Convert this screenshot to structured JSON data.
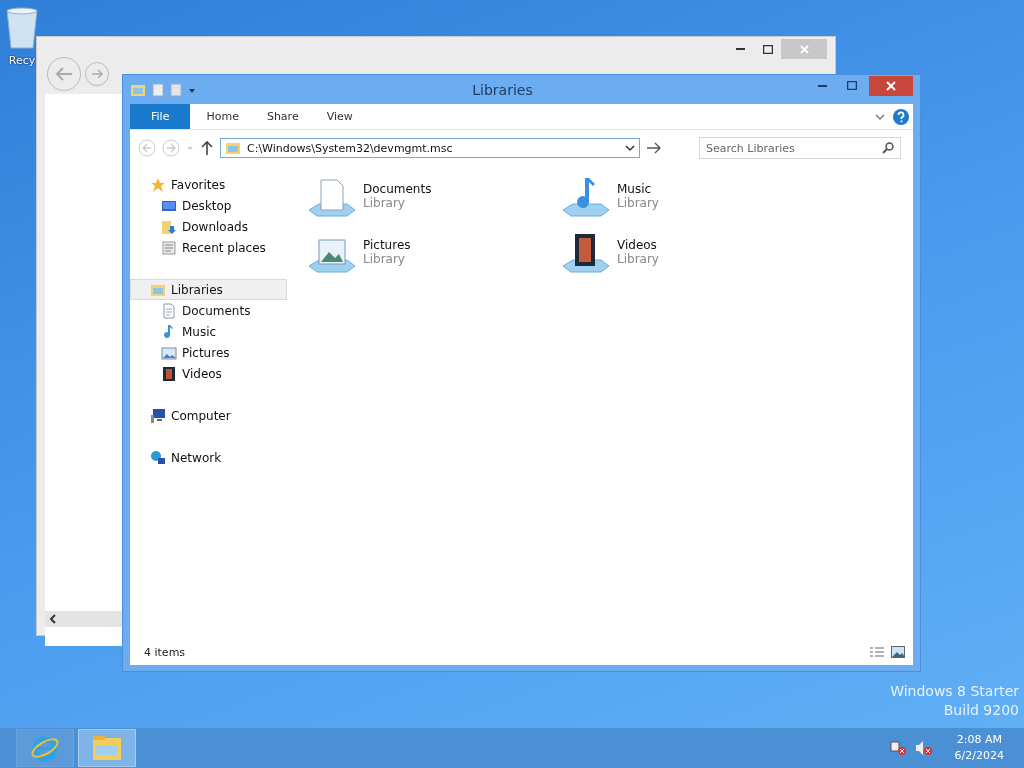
{
  "desktop_icons": [
    {
      "label": "Recy"
    }
  ],
  "browser": {
    "kind": "window"
  },
  "explorer": {
    "title": "Libraries",
    "ribbon_tabs": [
      {
        "label": "File",
        "kind": "menu"
      },
      {
        "label": "Home",
        "kind": "tab"
      },
      {
        "label": "Share",
        "kind": "tab"
      },
      {
        "label": "View",
        "kind": "tab"
      }
    ],
    "address": {
      "value": "C:\\Windows\\System32\\devmgmt.msc"
    },
    "search": {
      "placeholder": "Search Libraries"
    },
    "nav": [
      {
        "label": "Favorites",
        "selected": false,
        "children": [
          {
            "label": "Desktop",
            "selected": false
          },
          {
            "label": "Downloads",
            "selected": false
          },
          {
            "label": "Recent places",
            "selected": false
          }
        ]
      },
      {
        "label": "Libraries",
        "selected": true,
        "children": [
          {
            "label": "Documents",
            "selected": false
          },
          {
            "label": "Music",
            "selected": false
          },
          {
            "label": "Pictures",
            "selected": false
          },
          {
            "label": "Videos",
            "selected": false
          }
        ]
      },
      {
        "label": "Computer",
        "selected": false
      },
      {
        "label": "Network",
        "selected": false
      }
    ],
    "items": [
      {
        "name": "Documents",
        "type": "Library"
      },
      {
        "name": "Music",
        "type": "Library"
      },
      {
        "name": "Pictures",
        "type": "Library"
      },
      {
        "name": "Videos",
        "type": "Library"
      }
    ],
    "status": "4 items"
  },
  "edition": [
    "Windows 8 Starter",
    "Build 9200"
  ],
  "taskbar": {
    "apps": [
      {
        "selected": false
      },
      {
        "selected": true
      }
    ],
    "time": "2:08 AM",
    "date": "6/2/2024"
  }
}
